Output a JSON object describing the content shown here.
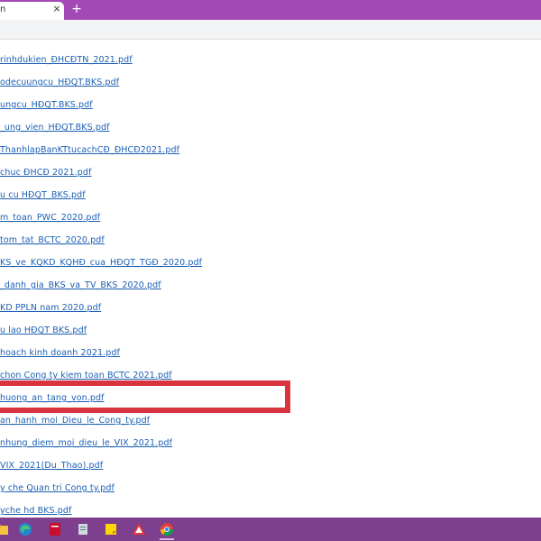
{
  "browser": {
    "tab_title": "n",
    "close_glyph": "×",
    "new_tab_glyph": "+"
  },
  "files": [
    "rinhdukien_ĐHCĐTN_2021.pdf",
    "odecuungcu_HĐQT.BKS.pdf",
    "ungcu_HĐQT.BKS.pdf",
    "_ung_vien_HĐQT.BKS.pdf",
    "ThanhlapBanKTtucachCĐ_ĐHCĐ2021.pdf",
    "chuc ĐHCĐ 2021.pdf",
    "u cu HĐQT_BKS.pdf",
    "m_toan_PWC_2020.pdf",
    "tom_tat_BCTC_2020.pdf",
    "KS_ve_KQKD_KQHĐ_cua_HĐQT_TGĐ_2020.pdf",
    "_danh_gia_BKS_va_TV_BKS_2020.pdf",
    "KD PPLN nam 2020.pdf",
    "u lao HĐQT BKS.pdf",
    "hoach kinh doanh 2021.pdf",
    "chon Cong ty kiem toan BCTC 2021.pdf",
    "huong_an_tang_von.pdf",
    "an_hanh_moi_Dieu_le_Cong_ty.pdf",
    "nhung_diem_moi_dieu_le_VIX_2021.pdf",
    "VIX_2021(Du_Thao).pdf",
    "y che Quan tri Cong ty.pdf",
    "yche hd BKS.pdf"
  ],
  "taskbar": {
    "icons": [
      "file-explorer-icon",
      "edge-browser-icon",
      "pdf-reader-icon",
      "notepad-icon",
      "sticky-notes-icon",
      "office-app-icon",
      "chrome-icon"
    ]
  },
  "colors": {
    "tab_strip": "#a349b5",
    "taskbar": "#7d3f8e",
    "link": "#1a5fb4",
    "highlight": "#d9333f"
  }
}
